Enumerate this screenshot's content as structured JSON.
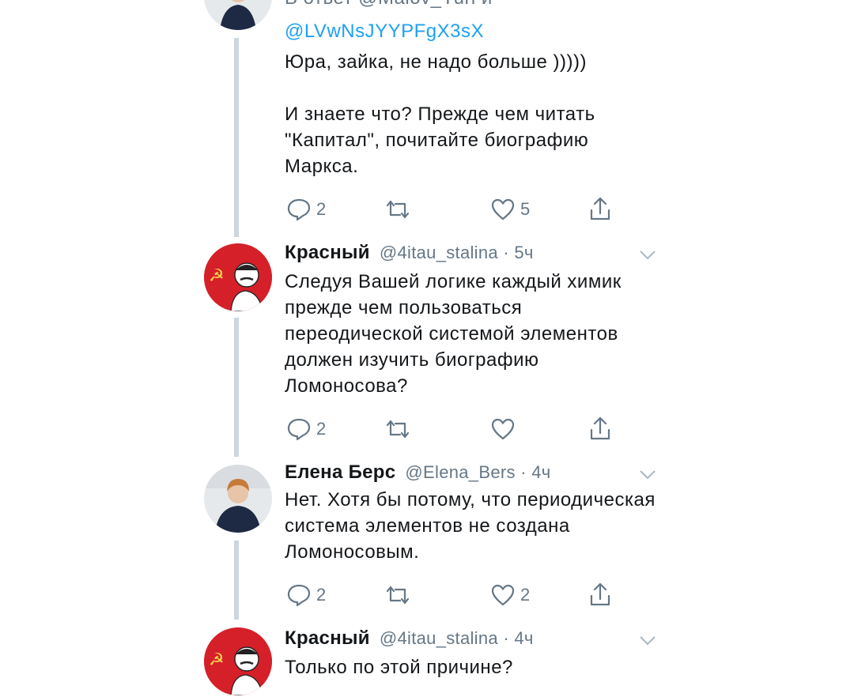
{
  "thread": {
    "tweet0": {
      "reply_prefix": "В ответ @Malov_Yuri и",
      "reply_handle": "@LVwNsJYYPFgX3sX",
      "text": "Юра, зайка, не надо больше )))))\n\nИ знаете что? Прежде чем читать \"Капитал\", почитайте биографию Маркса.",
      "replies": "2",
      "retweets": "",
      "likes": "5"
    },
    "tweet1": {
      "author": "Красный",
      "meta": "@4itau_stalina · 5ч",
      "text": "Следуя Вашей логике каждый химик прежде чем пользоваться переодической системой элементов должен изучить биографию Ломоносова?",
      "replies": "2",
      "retweets": "",
      "likes": ""
    },
    "tweet2": {
      "author": "Елена Берс",
      "meta": "@Elena_Bers · 4ч",
      "text": "Нет. Хотя бы потому, что периодическая система элементов не создана Ломоносовым.",
      "replies": "2",
      "retweets": "",
      "likes": "2"
    },
    "tweet3": {
      "author": "Красный",
      "meta": "@4itau_stalina · 4ч",
      "text": "Только по этой причине?"
    }
  },
  "icons": {
    "reply": "reply-icon",
    "retweet": "retweet-icon",
    "like": "heart-icon",
    "share": "share-icon",
    "more": "chevron-down-icon"
  },
  "colors": {
    "link": "#1da1f2",
    "muted": "#657786",
    "thread_line": "#ccd6dd",
    "stalin_avatar_bg": "#d5202a"
  }
}
